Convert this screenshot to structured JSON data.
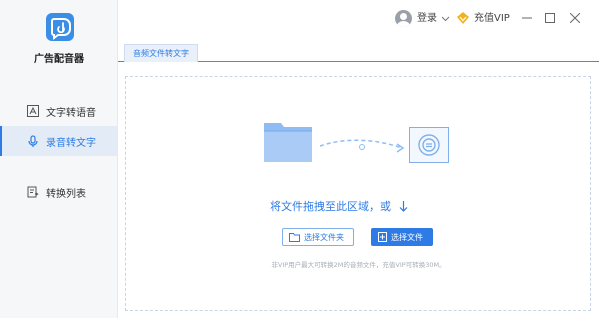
{
  "app": {
    "name": "广告配音器"
  },
  "sidebar": {
    "items": [
      {
        "label": "文字转语音",
        "icon": "text-to-speech-icon",
        "active": false
      },
      {
        "label": "录音转文字",
        "icon": "microphone-icon",
        "active": true
      },
      {
        "label": "转换列表",
        "icon": "conversion-list-icon",
        "active": false
      }
    ]
  },
  "topbar": {
    "login_label": "登录",
    "vip_label": "充值VIP"
  },
  "tabs": [
    {
      "label": "音频文件转文字",
      "active": true
    }
  ],
  "dropzone": {
    "prompt": "将文件拖拽至此区域，或",
    "select_folder_label": "选择文件夹",
    "select_file_label": "选择文件",
    "hint": "非VIP用户最大可转换2M的音频文件，充值VIP可转换30M。"
  },
  "colors": {
    "accent": "#2e7be5",
    "sidebar_bg": "#f6f7f9",
    "active_bg": "#e3ebf7",
    "vip_gold": "#f2b01e"
  }
}
